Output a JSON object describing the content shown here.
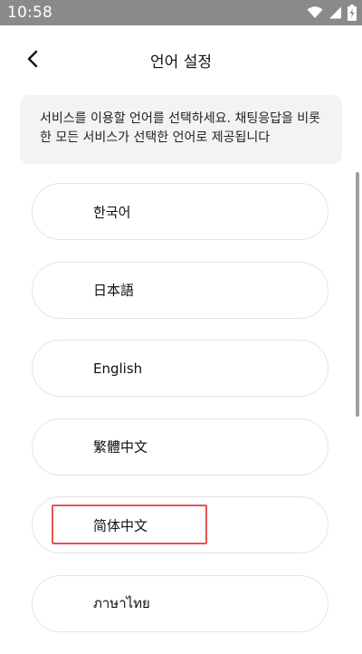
{
  "status_bar": {
    "time": "10:58",
    "icons": [
      "wifi-icon",
      "cellular-signal-icon",
      "battery-charging-icon"
    ]
  },
  "header": {
    "title": "언어 설정",
    "back_icon": "chevron-left-icon"
  },
  "info": {
    "text": "서비스를 이용할 언어를 선택하세요. 채팅응답을 비롯한 모든 서비스가 선택한 언어로 제공됩니다"
  },
  "languages": [
    {
      "label": "한국어"
    },
    {
      "label": "日本語"
    },
    {
      "label": "English"
    },
    {
      "label": "繁體中文"
    },
    {
      "label": "简体中文"
    },
    {
      "label": "ภาษาไทย"
    }
  ],
  "colors": {
    "status_bar": "#8a8a8a",
    "info_background": "#f3f3f3",
    "item_border": "#e4e4e4",
    "highlight": "#e05555"
  }
}
